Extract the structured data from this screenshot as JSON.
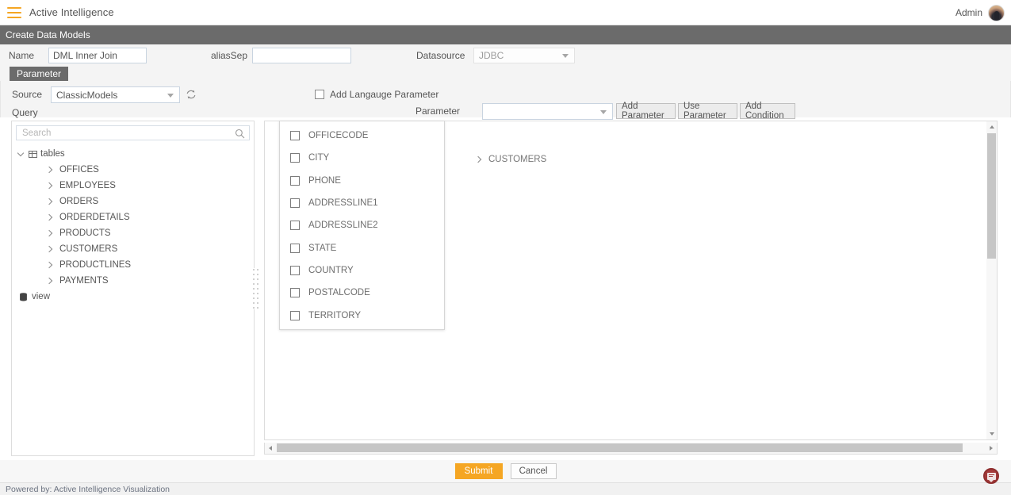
{
  "topbar": {
    "menu_icon": "hamburger-icon",
    "app_title": "Active Intelligence",
    "user_label": "Admin",
    "avatar_icon": "user-avatar"
  },
  "page": {
    "title": "Create Data Models"
  },
  "form": {
    "name_label": "Name",
    "name_value": "DML Inner Join",
    "aliassep_label": "aliasSep",
    "aliassep_value": "",
    "aliassep_placeholder": "",
    "datasource_label": "Datasource",
    "datasource_value": "JDBC"
  },
  "tabs": [
    {
      "label": "Parameter",
      "active": true
    }
  ],
  "parameters": {
    "source_label": "Source",
    "source_value": "ClassicModels",
    "refresh_icon": "refresh-icon",
    "add_language_parameter_label": "Add Langauge Parameter",
    "add_language_parameter_checked": false,
    "query_label": "Query",
    "parameter_label": "Parameter",
    "parameter_value": "",
    "buttons": [
      {
        "label": "Add Parameter"
      },
      {
        "label": "Use Parameter"
      },
      {
        "label": "Add Condition"
      }
    ]
  },
  "tree": {
    "search_placeholder": "Search",
    "search_value": "",
    "search_icon": "search-icon",
    "root": {
      "label": "tables",
      "icon": "grid-icon",
      "expanded": true,
      "children": [
        {
          "label": "OFFICES"
        },
        {
          "label": "EMPLOYEES"
        },
        {
          "label": "ORDERS"
        },
        {
          "label": "ORDERDETAILS"
        },
        {
          "label": "PRODUCTS"
        },
        {
          "label": "CUSTOMERS"
        },
        {
          "label": "PRODUCTLINES"
        },
        {
          "label": "PAYMENTS"
        }
      ]
    },
    "view_node": {
      "label": "view",
      "icon": "database-icon"
    }
  },
  "dropdown": {
    "items": [
      {
        "label": "OFFICECODE",
        "checked": false
      },
      {
        "label": "CITY",
        "checked": false
      },
      {
        "label": "PHONE",
        "checked": false
      },
      {
        "label": "ADDRESSLINE1",
        "checked": false
      },
      {
        "label": "ADDRESSLINE2",
        "checked": false
      },
      {
        "label": "STATE",
        "checked": false
      },
      {
        "label": "COUNTRY",
        "checked": false
      },
      {
        "label": "POSTALCODE",
        "checked": false
      },
      {
        "label": "TERRITORY",
        "checked": false
      }
    ]
  },
  "canvas": {
    "nodes": [
      {
        "label": "CUSTOMERS",
        "expanded": false
      }
    ]
  },
  "footer": {
    "submit_label": "Submit",
    "cancel_label": "Cancel",
    "powered_by": "Powered by: Active Intelligence Visualization",
    "chat_icon": "chat-bubble-icon"
  },
  "colors": {
    "accent_orange": "#f5a623",
    "header_gray": "#6b6b6b",
    "chat_red": "#a33a3a",
    "panel_bg": "#f4f4f4"
  }
}
